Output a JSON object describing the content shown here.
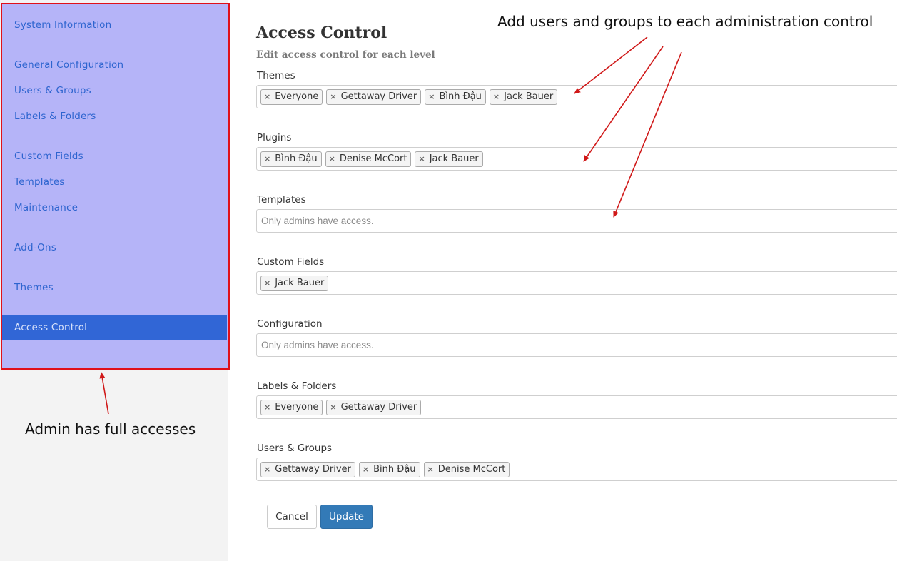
{
  "sidebar": {
    "items": [
      {
        "label": "System Information"
      },
      {
        "label": "General Configuration"
      },
      {
        "label": "Users & Groups"
      },
      {
        "label": "Labels & Folders"
      },
      {
        "label": "Custom Fields"
      },
      {
        "label": "Templates"
      },
      {
        "label": "Maintenance"
      },
      {
        "label": "Add-Ons"
      },
      {
        "label": "Themes"
      },
      {
        "label": "Access Control",
        "active": true
      }
    ]
  },
  "main": {
    "title": "Access Control",
    "subtitle": "Edit access control for each level",
    "fields": [
      {
        "label": "Themes",
        "tags": [
          "Everyone",
          "Gettaway Driver",
          "Bình Đậu",
          "Jack Bauer"
        ]
      },
      {
        "label": "Plugins",
        "tags": [
          "Bình Đậu",
          "Denise McCort",
          "Jack Bauer"
        ]
      },
      {
        "label": "Templates",
        "tags": [],
        "placeholder": "Only admins have access."
      },
      {
        "label": "Custom Fields",
        "tags": [
          "Jack Bauer"
        ]
      },
      {
        "label": "Configuration",
        "tags": [],
        "placeholder": "Only admins have access."
      },
      {
        "label": "Labels & Folders",
        "tags": [
          "Everyone",
          "Gettaway Driver"
        ]
      },
      {
        "label": "Users & Groups",
        "tags": [
          "Gettaway Driver",
          "Bình Đậu",
          "Denise McCort"
        ]
      }
    ],
    "cancel_label": "Cancel",
    "update_label": "Update"
  },
  "annotations": {
    "top": "Add users and groups to each administration control",
    "bottom": "Admin has full accesses"
  },
  "colors": {
    "annotation_outline": "#e0101a",
    "sidebar_overlay": "#b5b4f8",
    "active_item": "#3166d6",
    "link": "#2d64cf",
    "primary_button": "#337ab7"
  }
}
